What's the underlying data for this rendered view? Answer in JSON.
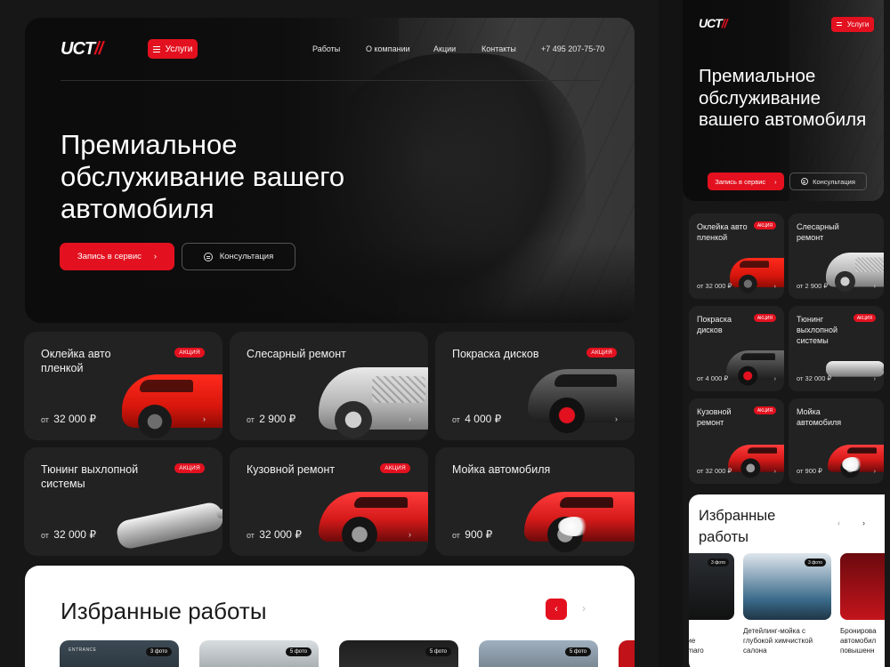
{
  "brand": {
    "logo_main": "UCT",
    "logo_accent": "//"
  },
  "header": {
    "menu_label": "Услуги",
    "nav": [
      "Работы",
      "О компании",
      "Акции",
      "Контакты"
    ],
    "phone": "+7 495 207-75-70"
  },
  "hero": {
    "title": "Премиальное обслуживание вашего автомобиля",
    "cta_label": "Запись в сервис",
    "consult_label": "Консультация"
  },
  "services": [
    {
      "title": "Оклейка авто пленкой",
      "price_prefix": "от",
      "price": "32 000 ₽",
      "badge": "АКЦИЯ"
    },
    {
      "title": "Слесарный ремонт",
      "price_prefix": "от",
      "price": "2 900 ₽",
      "badge": ""
    },
    {
      "title": "Покраска дисков",
      "price_prefix": "от",
      "price": "4 000 ₽",
      "badge": "АКЦИЯ"
    },
    {
      "title": "Тюнинг выхлопной системы",
      "price_prefix": "от",
      "price": "32 000 ₽",
      "badge": "АКЦИЯ"
    },
    {
      "title": "Кузовной ремонт",
      "price_prefix": "от",
      "price": "32 000 ₽",
      "badge": "АКЦИЯ"
    },
    {
      "title": "Мойка автомобиля",
      "price_prefix": "от",
      "price": "900 ₽",
      "badge": ""
    }
  ],
  "works": {
    "title": "Избранные работы",
    "photos_label": "5 фото",
    "photos_label_alt": "3 фото",
    "entrance_sign": "ENTRANCE",
    "mobile_captions": [
      "е\nние\namaro",
      "Детейлинг-мойка с\nглубокой химчисткой\nсалона",
      "Бронирова\nавтомобил\nповышенн"
    ]
  },
  "mobile": {
    "title": "Премиальное обслуживание вашего автомобиля",
    "prices": [
      "от 32 000 ₽",
      "от 2 900 ₽",
      "от 4 000 ₽",
      "от 32 000 ₽",
      "от 32 000 ₽",
      "от 900 ₽"
    ]
  },
  "colors": {
    "accent": "#e3111f",
    "bg": "#171717",
    "card": "#222222"
  }
}
